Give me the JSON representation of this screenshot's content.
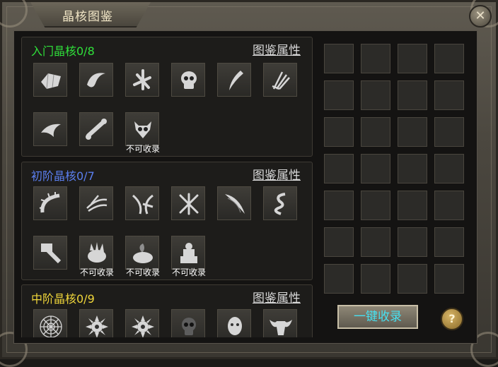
{
  "window": {
    "title": "晶核图鉴",
    "close_icon": "close-icon"
  },
  "sections": [
    {
      "title": "入门晶核0/8",
      "title_color": "#2fe03a",
      "attr_link": "图鉴属性",
      "items": [
        {
          "icon": "gauntlet-icon",
          "note": ""
        },
        {
          "icon": "horn-icon",
          "note": ""
        },
        {
          "icon": "bone-pile-icon",
          "note": ""
        },
        {
          "icon": "skull-icon",
          "note": ""
        },
        {
          "icon": "fang-icon",
          "note": ""
        },
        {
          "icon": "claw-hand-icon",
          "note": ""
        },
        {
          "icon": "claw-icon",
          "note": ""
        },
        {
          "icon": "bone-icon",
          "note": ""
        },
        {
          "icon": "demon-skull-icon",
          "note": "不可收录"
        }
      ]
    },
    {
      "title": "初阶晶核0/7",
      "title_color": "#5b7ff0",
      "attr_link": "图鉴属性",
      "items": [
        {
          "icon": "spine-icon",
          "note": ""
        },
        {
          "icon": "spider-leg-icon",
          "note": ""
        },
        {
          "icon": "tendril-icon",
          "note": ""
        },
        {
          "icon": "bone-cross-icon",
          "note": ""
        },
        {
          "icon": "tusk-icon",
          "note": ""
        },
        {
          "icon": "serpent-icon",
          "note": ""
        },
        {
          "icon": "war-hammer-icon",
          "note": ""
        },
        {
          "icon": "spiked-shell-icon",
          "note": "不可收录"
        },
        {
          "icon": "cauldron-icon",
          "note": "不可收录"
        },
        {
          "icon": "altar-icon",
          "note": "不可收录"
        }
      ]
    },
    {
      "title": "中阶晶核0/9",
      "title_color": "#f0d63a",
      "attr_link": "图鉴属性",
      "items": [
        {
          "icon": "spider-web-icon",
          "note": ""
        },
        {
          "icon": "spiked-orb-icon",
          "note": ""
        },
        {
          "icon": "spiked-orb-icon",
          "note": ""
        },
        {
          "icon": "dark-skull-icon",
          "note": ""
        },
        {
          "icon": "head-icon",
          "note": ""
        },
        {
          "icon": "bull-skull-icon",
          "note": ""
        }
      ]
    }
  ],
  "grid": {
    "rows": 7,
    "cols": 4
  },
  "buttons": {
    "collect_all": "一键收录",
    "help": "?"
  }
}
